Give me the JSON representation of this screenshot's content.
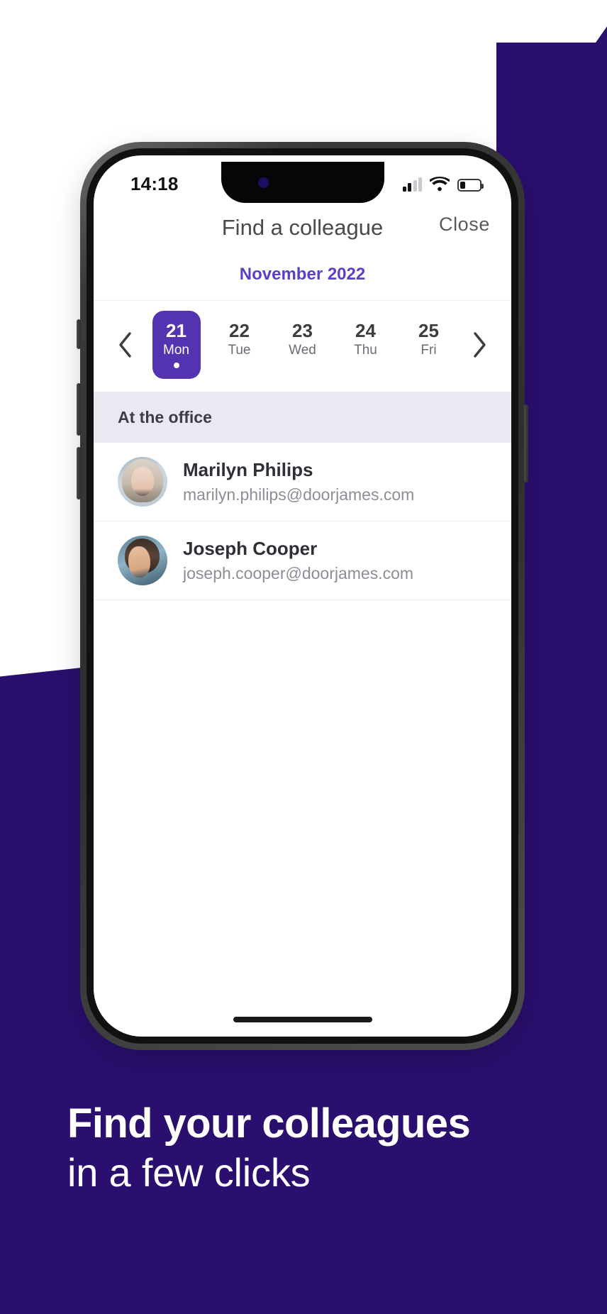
{
  "colors": {
    "brand_purple": "#2a0f6e",
    "accent_purple": "#5333b0",
    "month_label": "#5b3fc4",
    "section_bg": "#e9e9f2",
    "pink_sliver": "#fde9ec"
  },
  "status_bar": {
    "time": "14:18",
    "signal_icon": "signal-bars-icon",
    "signal_bars_filled": 2,
    "signal_bars_total": 4,
    "wifi_icon": "wifi-icon",
    "battery_icon": "battery-icon",
    "battery_percent": 26
  },
  "app_header": {
    "title": "Find a colleague",
    "close_label": "Close"
  },
  "calendar": {
    "month_label": "November 2022",
    "prev_icon": "chevron-left-icon",
    "next_icon": "chevron-right-icon",
    "days": [
      {
        "num": "21",
        "name": "Mon",
        "selected": true,
        "has_dot": true
      },
      {
        "num": "22",
        "name": "Tue",
        "selected": false,
        "has_dot": false
      },
      {
        "num": "23",
        "name": "Wed",
        "selected": false,
        "has_dot": false
      },
      {
        "num": "24",
        "name": "Thu",
        "selected": false,
        "has_dot": false
      },
      {
        "num": "25",
        "name": "Fri",
        "selected": false,
        "has_dot": false
      }
    ]
  },
  "section": {
    "label": "At the office"
  },
  "contacts": [
    {
      "name": "Marilyn Philips",
      "email": "marilyn.philips@doorjames.com",
      "avatar": "avatar-marilyn-philips",
      "avatar_style": "female"
    },
    {
      "name": "Joseph Cooper",
      "email": "joseph.cooper@doorjames.com",
      "avatar": "avatar-joseph-cooper",
      "avatar_style": "male"
    }
  ],
  "caption": {
    "line1": "Find your colleagues",
    "line2": "in a few clicks"
  }
}
